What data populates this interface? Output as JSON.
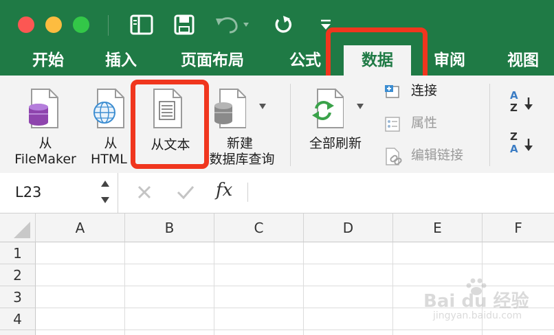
{
  "tabs": [
    {
      "label": "开始"
    },
    {
      "label": "插入"
    },
    {
      "label": "页面布局"
    },
    {
      "label": "公式"
    },
    {
      "label": "数据",
      "active": true
    },
    {
      "label": "审阅"
    },
    {
      "label": "视图"
    }
  ],
  "ribbon": {
    "from_filemaker": {
      "line1": "从",
      "line2": "FileMaker"
    },
    "from_html": {
      "line1": "从",
      "line2": "HTML"
    },
    "from_text": "从文本",
    "new_query": {
      "line1": "新建",
      "line2": "数据库查询"
    },
    "refresh_all": "全部刷新",
    "connections": "连接",
    "properties": "属性",
    "edit_links": "编辑链接",
    "sort_az": {
      "top": "A",
      "bottom": "Z"
    },
    "sort_za": {
      "top": "Z",
      "bottom": "A"
    }
  },
  "formula_bar": {
    "name_box": "L23",
    "fx": "fx",
    "value": ""
  },
  "grid": {
    "columns": [
      "A",
      "B",
      "C",
      "D",
      "E",
      "F"
    ],
    "rows": [
      "1",
      "2",
      "3",
      "4"
    ]
  },
  "watermark": {
    "line1": "Bai du 经验",
    "line2": "jingyan.baidu.com"
  },
  "colors": {
    "excel_green": "#1f7a45",
    "highlight_red": "#f0361e"
  }
}
